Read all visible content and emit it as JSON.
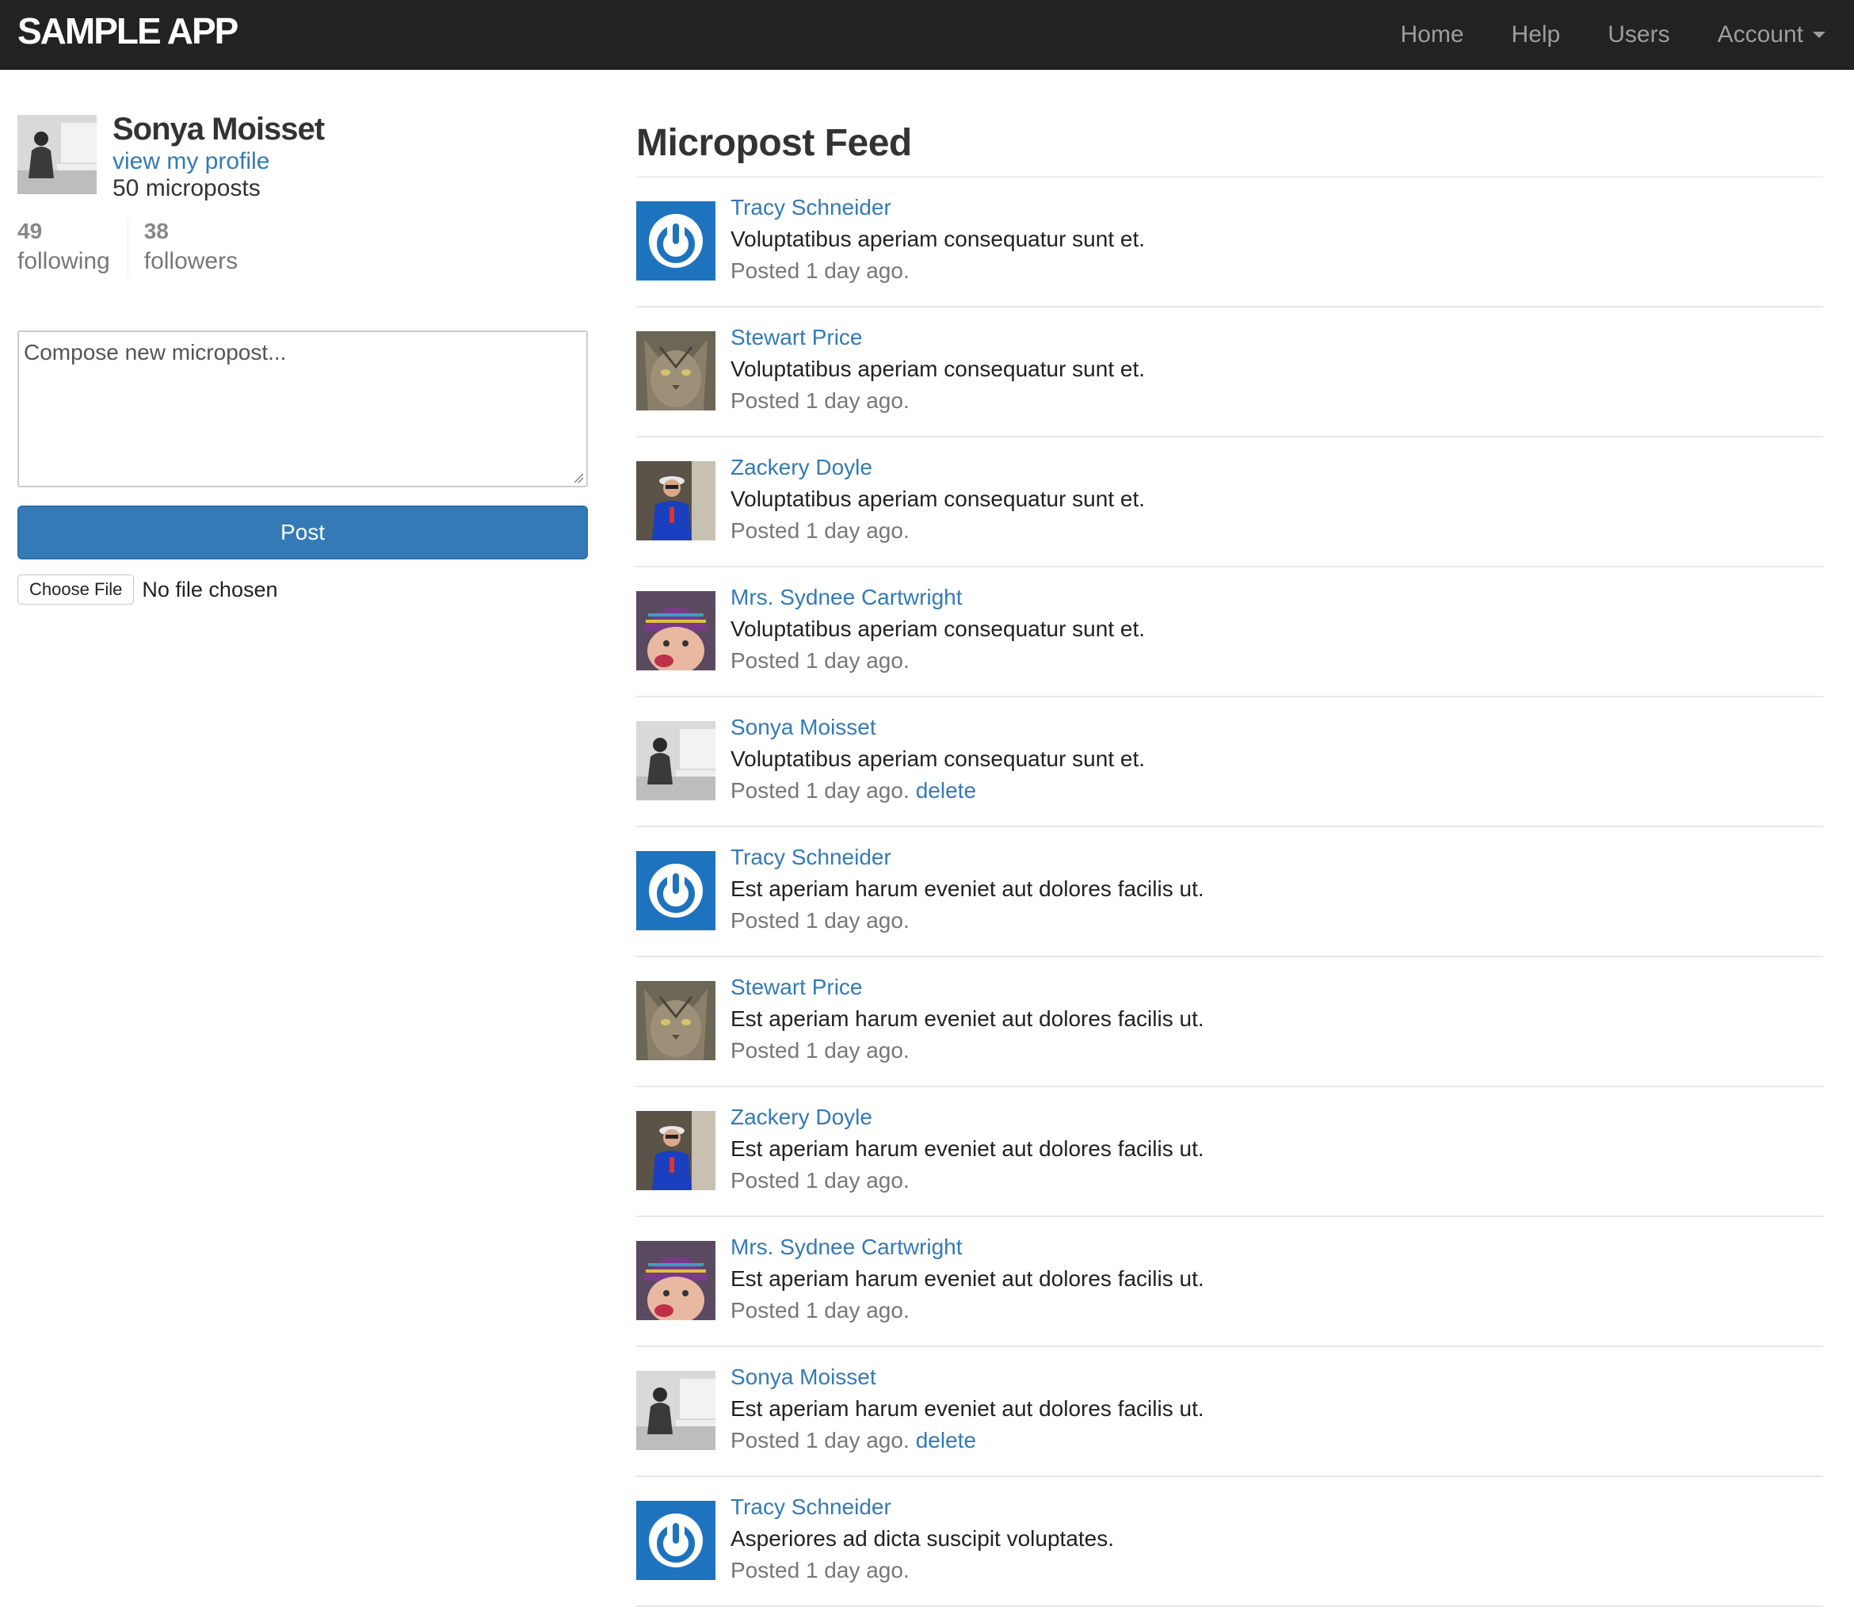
{
  "navbar": {
    "brand": "SAMPLE APP",
    "links": [
      "Home",
      "Help",
      "Users",
      "Account"
    ]
  },
  "sidebar": {
    "name": "Sonya Moisset",
    "profile_link": "view my profile",
    "micropost_count": "50 microposts",
    "stats": [
      {
        "number": "49",
        "label": "following"
      },
      {
        "number": "38",
        "label": "followers"
      }
    ],
    "compose_placeholder": "Compose new micropost...",
    "post_button": "Post",
    "file_button": "Choose File",
    "file_status": "No file chosen"
  },
  "feed": {
    "title": "Micropost Feed",
    "items": [
      {
        "user": "Tracy Schneider",
        "content": "Voluptatibus aperiam consequatur sunt et.",
        "time": "Posted 1 day ago.",
        "delete": "",
        "avatar": "power-icon"
      },
      {
        "user": "Stewart Price",
        "content": "Voluptatibus aperiam consequatur sunt et.",
        "time": "Posted 1 day ago.",
        "delete": "",
        "avatar": "cat-photo"
      },
      {
        "user": "Zackery Doyle",
        "content": "Voluptatibus aperiam consequatur sunt et.",
        "time": "Posted 1 day ago.",
        "delete": "",
        "avatar": "person-blue-shirt"
      },
      {
        "user": "Mrs. Sydnee Cartwright",
        "content": "Voluptatibus aperiam consequatur sunt et.",
        "time": "Posted 1 day ago.",
        "delete": "",
        "avatar": "baby-beanie"
      },
      {
        "user": "Sonya Moisset",
        "content": "Voluptatibus aperiam consequatur sunt et.",
        "time": "Posted 1 day ago.",
        "delete": "delete",
        "avatar": "woman-grayscale"
      },
      {
        "user": "Tracy Schneider",
        "content": "Est aperiam harum eveniet aut dolores facilis ut.",
        "time": "Posted 1 day ago.",
        "delete": "",
        "avatar": "power-icon"
      },
      {
        "user": "Stewart Price",
        "content": "Est aperiam harum eveniet aut dolores facilis ut.",
        "time": "Posted 1 day ago.",
        "delete": "",
        "avatar": "cat-photo"
      },
      {
        "user": "Zackery Doyle",
        "content": "Est aperiam harum eveniet aut dolores facilis ut.",
        "time": "Posted 1 day ago.",
        "delete": "",
        "avatar": "person-blue-shirt"
      },
      {
        "user": "Mrs. Sydnee Cartwright",
        "content": "Est aperiam harum eveniet aut dolores facilis ut.",
        "time": "Posted 1 day ago.",
        "delete": "",
        "avatar": "baby-beanie"
      },
      {
        "user": "Sonya Moisset",
        "content": "Est aperiam harum eveniet aut dolores facilis ut.",
        "time": "Posted 1 day ago.",
        "delete": "delete",
        "avatar": "woman-grayscale"
      },
      {
        "user": "Tracy Schneider",
        "content": "Asperiores ad dicta suscipit voluptates.",
        "time": "Posted 1 day ago.",
        "delete": "",
        "avatar": "power-icon"
      }
    ]
  },
  "colors": {
    "navbar_bg": "#222222",
    "link": "#337ab7",
    "button": "#337ab7"
  }
}
